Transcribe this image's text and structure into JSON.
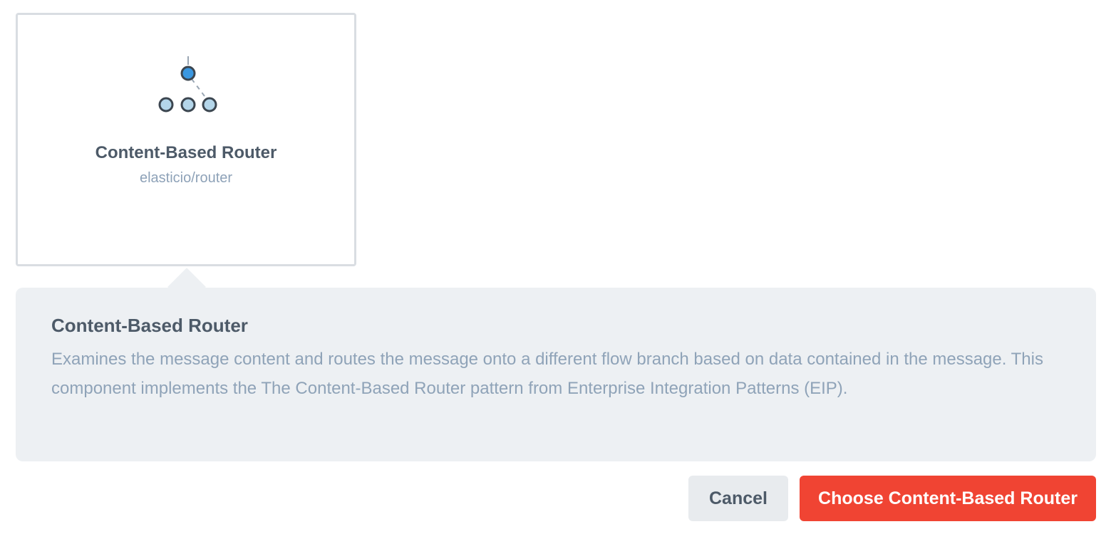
{
  "card": {
    "icon": "router-tree-icon",
    "title": "Content-Based Router",
    "subtitle": "elasticio/router"
  },
  "details": {
    "title": "Content-Based Router",
    "description": "Examines the message content and routes the message onto a different flow branch based on data contained in the message. This component implements the The Content-Based Router pattern from Enterprise Integration Patterns (EIP)."
  },
  "actions": {
    "cancel_label": "Cancel",
    "choose_label": "Choose Content-Based Router"
  },
  "colors": {
    "accent": "#f04433",
    "node_active": "#3a97e0",
    "node_inactive": "#b4d6ea"
  }
}
